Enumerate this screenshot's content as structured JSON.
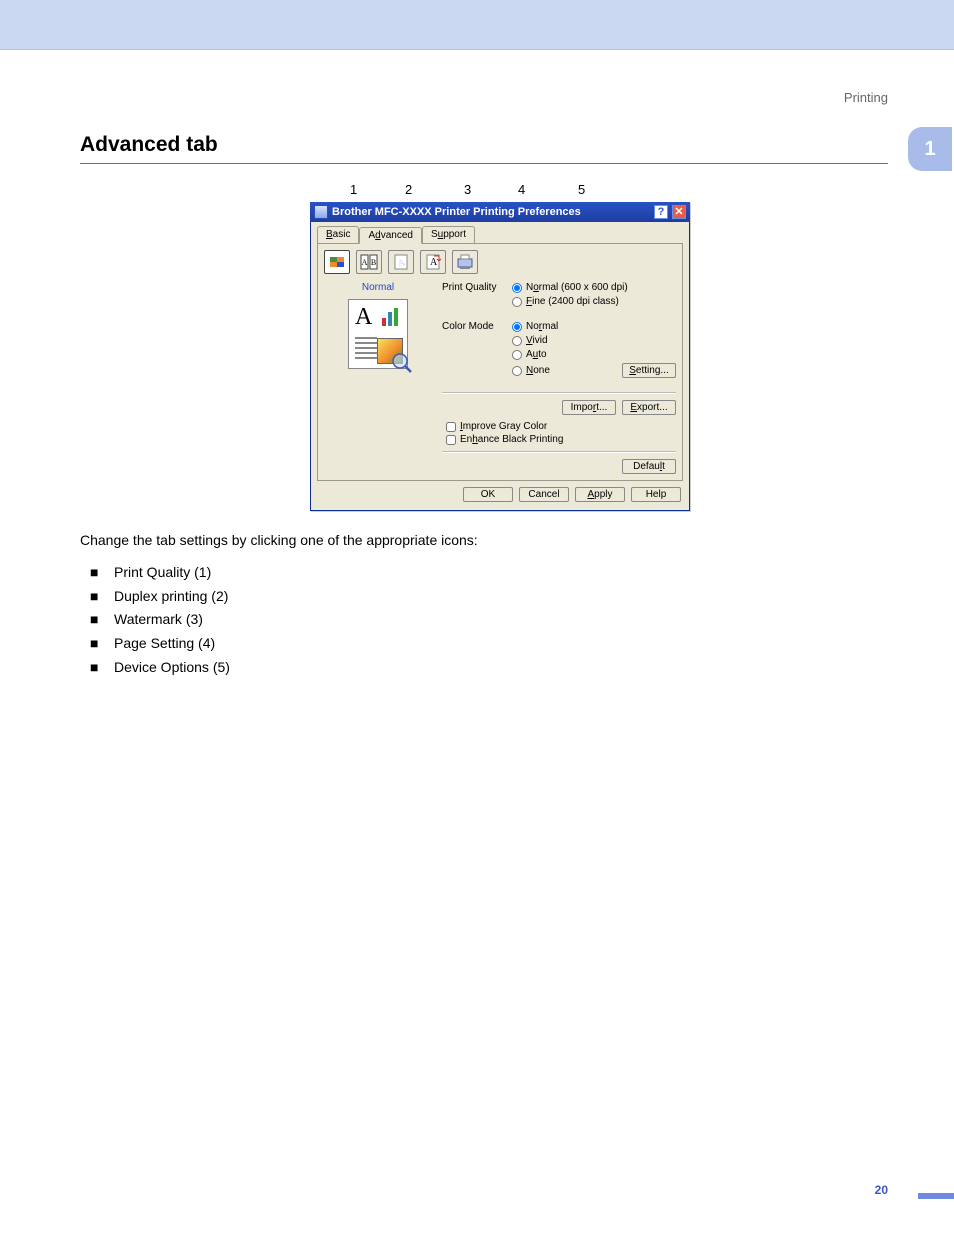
{
  "header": {
    "category": "Printing",
    "section_number": "1",
    "page_number": "20"
  },
  "section": {
    "title": "Advanced tab"
  },
  "callouts": [
    "1",
    "2",
    "3",
    "4",
    "5"
  ],
  "dialog": {
    "title": "Brother MFC-XXXX Printer Printing Preferences",
    "tabs": {
      "basic": "Basic",
      "advanced": "Advanced",
      "support": "Support"
    },
    "iconbar": {
      "i1": "print-quality-icon",
      "i2": "duplex-icon",
      "i3": "watermark-icon",
      "i4": "page-setting-icon",
      "i5": "device-options-icon"
    },
    "left": {
      "mode_label": "Normal",
      "big_letter": "A"
    },
    "print_quality": {
      "label": "Print Quality",
      "opt1": "Normal (600 x 600 dpi)",
      "opt2": "Fine (2400 dpi class)"
    },
    "color_mode": {
      "label": "Color Mode",
      "opt1": "Normal",
      "opt2": "Vivid",
      "opt3": "Auto",
      "opt4": "None"
    },
    "buttons": {
      "setting": "Setting...",
      "import": "Import...",
      "export": "Export...",
      "default": "Default"
    },
    "checks": {
      "improve_gray": "Improve Gray Color",
      "enhance_black": "Enhance Black Printing"
    },
    "footer": {
      "ok": "OK",
      "cancel": "Cancel",
      "apply": "Apply",
      "help": "Help"
    }
  },
  "body": {
    "intro": "Change the tab settings by clicking one of the appropriate icons:",
    "items": {
      "i1": "Print Quality (1)",
      "i2": "Duplex printing (2)",
      "i3": "Watermark (3)",
      "i4": "Page Setting (4)",
      "i5": "Device Options (5)"
    }
  }
}
